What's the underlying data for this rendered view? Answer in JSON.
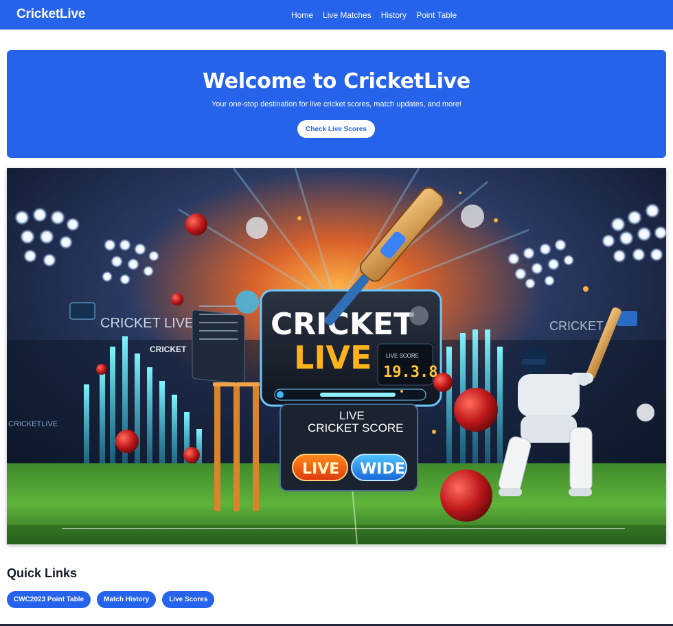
{
  "header": {
    "brand": "CricketLive",
    "nav": [
      "Home",
      "Live Matches",
      "History",
      "Point Table"
    ]
  },
  "hero": {
    "title": "Welcome to CricketLive",
    "subtitle": "Your one-stop destination for live cricket scores, match updates, and more!",
    "cta_label": "Check Live Scores"
  },
  "banner": {
    "logo_text": "CRICKET LIVE",
    "small_logo": "CRICKET",
    "side_text": "CRICKETLIVE",
    "right_sign": "CRICKET",
    "board_title_1": "CRICKET",
    "board_title_2": "LIVE",
    "score": "19.3.8",
    "score_label": "LIVE SCORE",
    "board_sub_1": "LIVE",
    "board_sub_2": "CRICKET SCORE",
    "btn_live": "LIVE",
    "btn_wide": "WIDE"
  },
  "quick_links": {
    "title": "Quick Links",
    "items": [
      "CWC2023 Point Table",
      "Match History",
      "Live Scores"
    ]
  },
  "colors": {
    "primary": "#2563eb",
    "text_dark": "#111827"
  }
}
